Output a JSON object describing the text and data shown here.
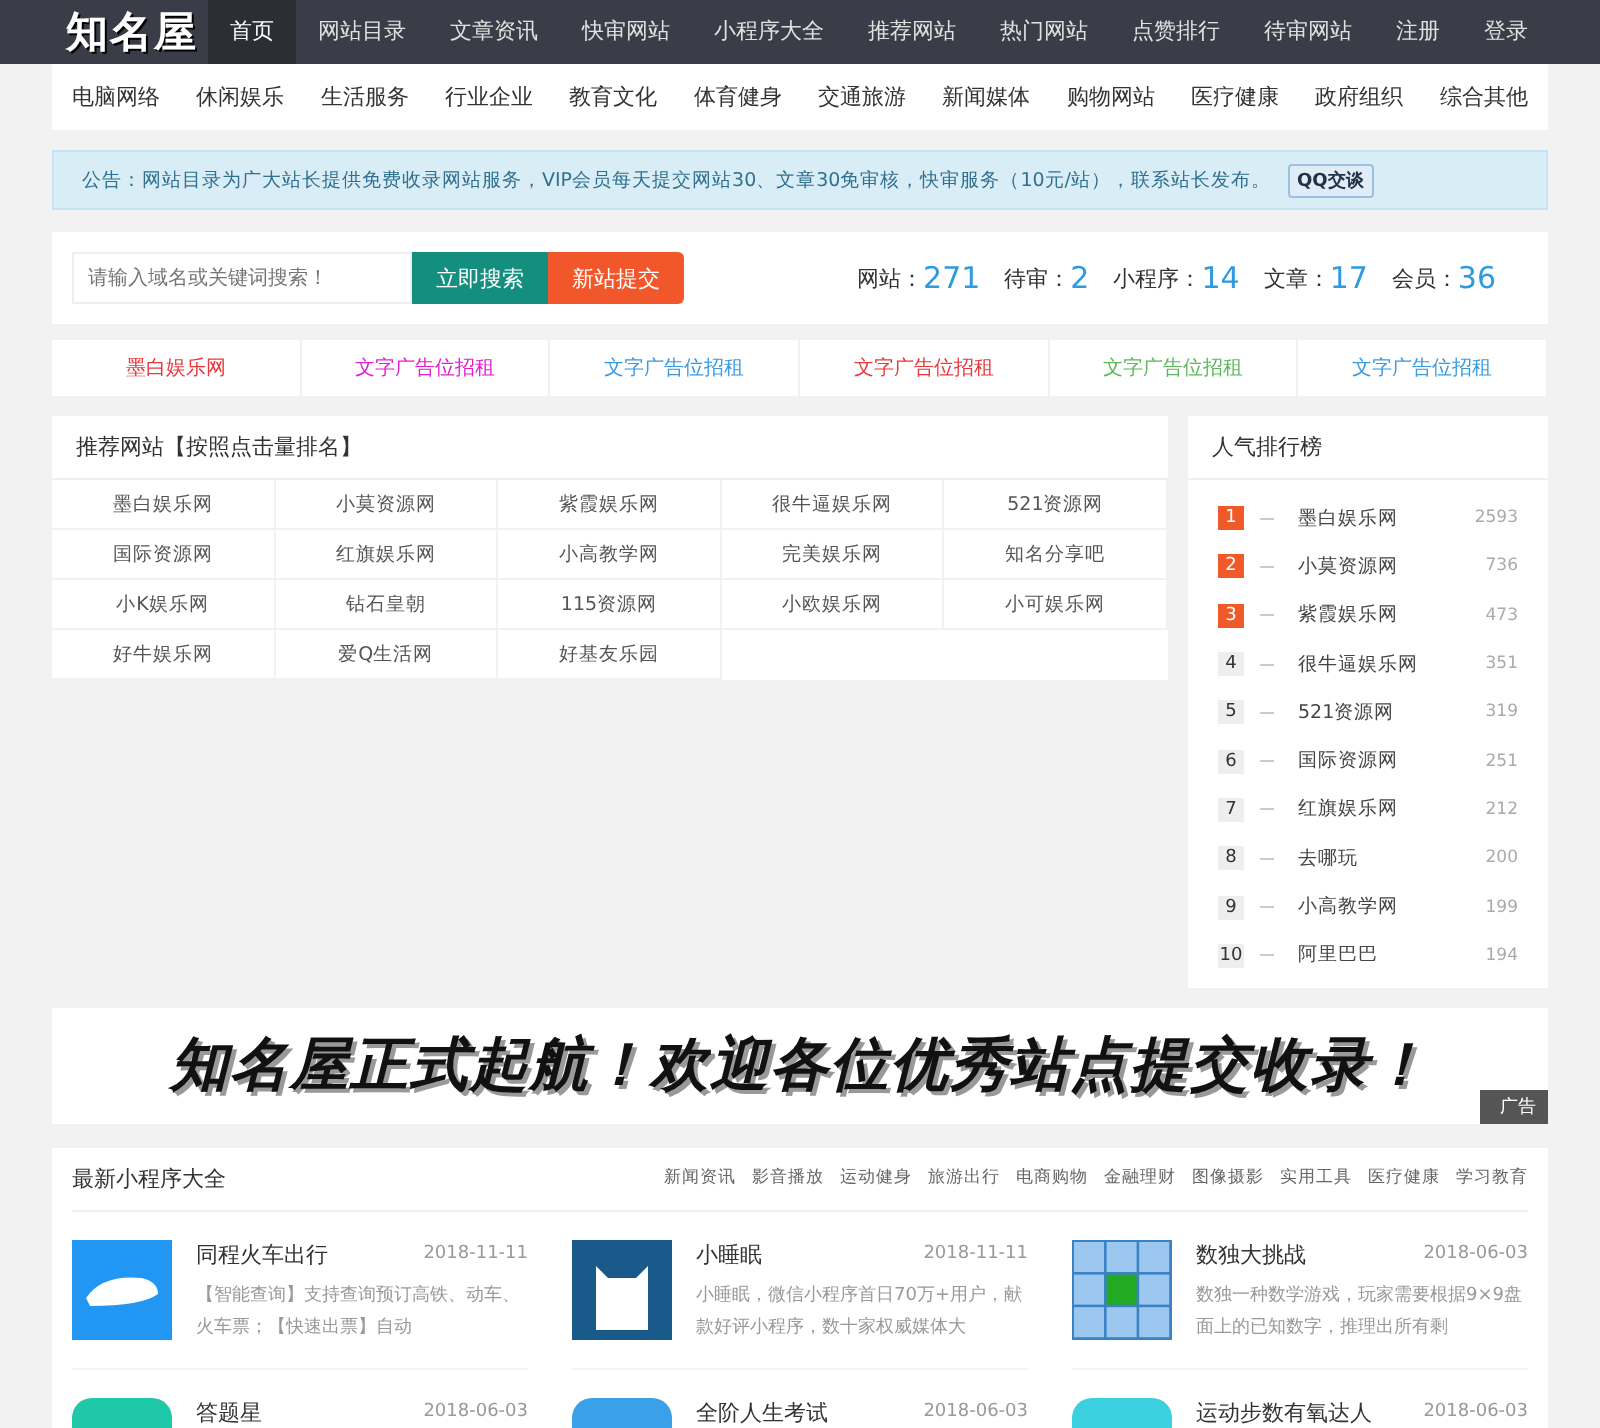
{
  "header": {
    "logo": "知名屋",
    "nav": [
      {
        "label": "首页",
        "selected": true
      },
      {
        "label": "网站目录",
        "selected": false
      },
      {
        "label": "文章资讯",
        "selected": false
      },
      {
        "label": "快审网站",
        "selected": false
      },
      {
        "label": "小程序大全",
        "selected": false
      },
      {
        "label": "推荐网站",
        "selected": false
      },
      {
        "label": "热门网站",
        "selected": false
      },
      {
        "label": "点赞排行",
        "selected": false
      },
      {
        "label": "待审网站",
        "selected": false
      }
    ],
    "user_links": [
      "注册",
      "登录"
    ]
  },
  "categories": [
    "电脑网络",
    "休闲娱乐",
    "生活服务",
    "行业企业",
    "教育文化",
    "体育健身",
    "交通旅游",
    "新闻媒体",
    "购物网站",
    "医疗健康",
    "政府组织",
    "综合其他"
  ],
  "notice": {
    "text": "公告：网站目录为广大站长提供免费收录网站服务，VIP会员每天提交网站30、文章30免审核，快审服务（10元/站），联系站长发布。",
    "button": "QQ交谈"
  },
  "search": {
    "placeholder": "请输入域名或关键词搜索！",
    "search_button": "立即搜索",
    "submit_button": "新站提交"
  },
  "stats": [
    {
      "label": "网站：",
      "value": "271"
    },
    {
      "label": "待审：",
      "value": "2"
    },
    {
      "label": "小程序：",
      "value": "14"
    },
    {
      "label": "文章：",
      "value": "17"
    },
    {
      "label": "会员：",
      "value": "36"
    }
  ],
  "ads": [
    {
      "text": "墨白娱乐网",
      "color": "#e8383d"
    },
    {
      "text": "文字广告位招租",
      "color": "#e020d0"
    },
    {
      "text": "文字广告位招租",
      "color": "#3a9ae0"
    },
    {
      "text": "文字广告位招租",
      "color": "#e8383d"
    },
    {
      "text": "文字广告位招租",
      "color": "#5cb85c"
    },
    {
      "text": "文字广告位招租",
      "color": "#3a9ae0"
    }
  ],
  "recommended": {
    "title": "推荐网站【按照点击量排名】",
    "sites": [
      "墨白娱乐网",
      "小莫资源网",
      "紫霞娱乐网",
      "很牛逼娱乐网",
      "521资源网",
      "国际资源网",
      "红旗娱乐网",
      "小高教学网",
      "完美娱乐网",
      "知名分享吧",
      "小K娱乐网",
      "钻石皇朝",
      "115资源网",
      "小欧娱乐网",
      "小可娱乐网",
      "好牛娱乐网",
      "爱Q生活网",
      "好基友乐园"
    ]
  },
  "ranking": {
    "title": "人气排行榜",
    "items": [
      {
        "rank": "1",
        "hot": true,
        "name": "墨白娱乐网",
        "count": "2593"
      },
      {
        "rank": "2",
        "hot": true,
        "name": "小莫资源网",
        "count": "736"
      },
      {
        "rank": "3",
        "hot": true,
        "name": "紫霞娱乐网",
        "count": "473"
      },
      {
        "rank": "4",
        "hot": false,
        "name": "很牛逼娱乐网",
        "count": "351"
      },
      {
        "rank": "5",
        "hot": false,
        "name": "521资源网",
        "count": "319"
      },
      {
        "rank": "6",
        "hot": false,
        "name": "国际资源网",
        "count": "251"
      },
      {
        "rank": "7",
        "hot": false,
        "name": "红旗娱乐网",
        "count": "212"
      },
      {
        "rank": "8",
        "hot": false,
        "name": "去哪玩",
        "count": "200"
      },
      {
        "rank": "9",
        "hot": false,
        "name": "小高教学网",
        "count": "199"
      },
      {
        "rank": "10",
        "hot": false,
        "name": "阿里巴巴",
        "count": "194"
      }
    ]
  },
  "banner": {
    "text": "知名屋正式起航！欢迎各位优秀站点提交收录！",
    "tag": "广告"
  },
  "mini_programs": {
    "title": "最新小程序大全",
    "tabs": [
      "新闻资讯",
      "影音播放",
      "运动健身",
      "旅游出行",
      "电商购物",
      "金融理财",
      "图像摄影",
      "实用工具",
      "医疗健康",
      "学习教育"
    ],
    "items": [
      {
        "kind": "train",
        "color": "#2196f3",
        "name": "同程火车出行",
        "date": "2018-11-11",
        "desc": "【智能查询】支持查询预订高铁、动车、火车票；【快速出票】自动"
      },
      {
        "kind": "cat",
        "color": "#1a5a8a",
        "name": "小睡眠",
        "date": "2018-11-11",
        "desc": "小睡眠，微信小程序首日70万+用户，献款好评小程序，数十家权威媒体大"
      },
      {
        "kind": "grid",
        "color": "#3b82c4",
        "name": "数独大挑战",
        "date": "2018-06-03",
        "desc": "数独一种数学游戏，玩家需要根据9×9盘面上的已知数字，推理出所有剩"
      },
      {
        "kind": "plain",
        "color": "#1fc8a8",
        "name": "答题星",
        "date": "2018-06-03"
      },
      {
        "kind": "plain",
        "color": "#3aa0e8",
        "name": "全阶人生考试",
        "date": "2018-06-03"
      },
      {
        "kind": "plain",
        "color": "#3ad0e0",
        "name": "运动步数有氧达人",
        "date": "2018-06-03"
      }
    ]
  }
}
